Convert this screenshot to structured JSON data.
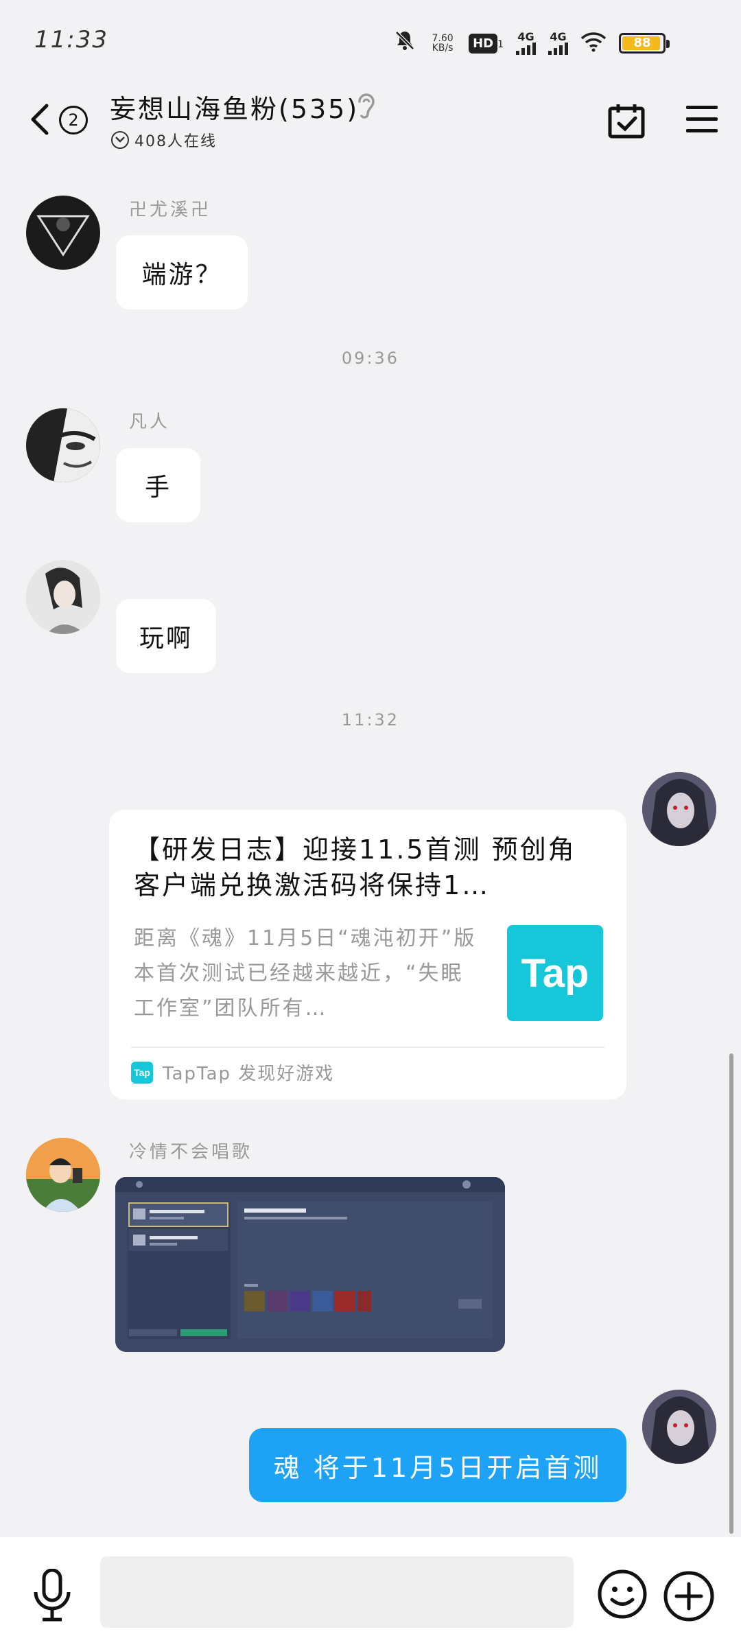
{
  "status_bar": {
    "time": "11:33",
    "speed_value": "7.60",
    "speed_unit": "KB/s",
    "hd": "HD",
    "hd_sub": "1",
    "net1": "4G",
    "net2": "4G",
    "battery_pct": "88",
    "battery_level": 0.88,
    "battery_color": "#f5b91b"
  },
  "header": {
    "back_icon": "chevron-left-icon",
    "unread_count": "2",
    "title": "妄想山海鱼粉(535)",
    "online_text": "408人在线"
  },
  "messages": {
    "m1": {
      "sender": "卍尤溪卍",
      "text": "端游？"
    },
    "t1": "09:36",
    "m2": {
      "sender": "凡人",
      "text": "手"
    },
    "m3": {
      "text": "玩啊"
    },
    "t2": "11:32",
    "card": {
      "title": "【研发日志】迎接11.5首测 预创角 客户端兑换激活码将保持1…",
      "desc": "距离《魂》11月5日“魂沌初开”版本首次测试已经越来越近，“失眠工作室”团队所有…",
      "logo_text": "Tap",
      "source_logo": "Tap",
      "source": "TapTap 发现好游戏"
    },
    "m5": {
      "sender": "冷情不会唱歌"
    },
    "m6": {
      "text": "魂 将于11月5日开启首测"
    }
  },
  "colors": {
    "accent_blue": "#1ea2f6",
    "tap_cyan": "#16c6d9"
  }
}
